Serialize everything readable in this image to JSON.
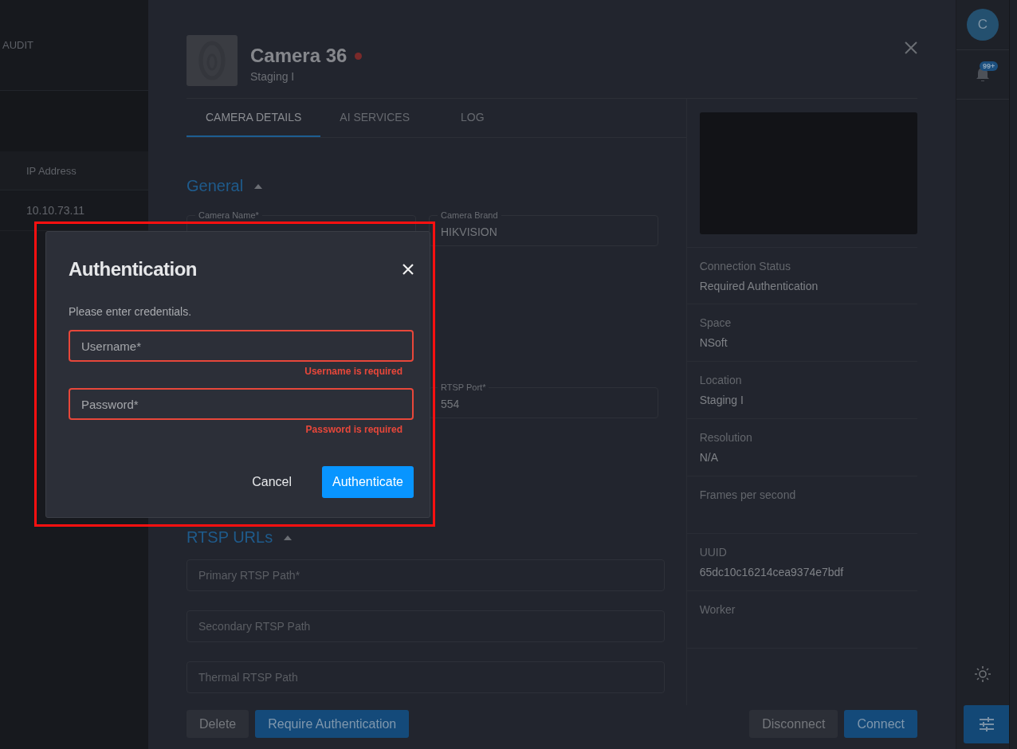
{
  "background_list": {
    "tab": "AUDIT",
    "column": "IP Address",
    "rows": [
      "10.10.73.11"
    ]
  },
  "camera": {
    "name": "Camera 36",
    "online": false,
    "subtitle": "Staging I"
  },
  "tabs": [
    {
      "label": "CAMERA DETAILS",
      "selected": true
    },
    {
      "label": "AI SERVICES",
      "selected": false
    },
    {
      "label": "LOG",
      "selected": false
    }
  ],
  "general": {
    "title": "General",
    "expanded": true,
    "fields": [
      {
        "label": "Camera Name*"
      },
      {
        "label": "Camera Brand",
        "value": "HIKVISION"
      },
      {
        "label": "RTSP Port*",
        "value": "554"
      }
    ]
  },
  "rtsp_urls": {
    "title": "RTSP URLs",
    "expanded": true,
    "fields": [
      {
        "placeholder": "Primary RTSP Path*"
      },
      {
        "placeholder": "Secondary RTSP Path"
      },
      {
        "placeholder": "Thermal RTSP Path"
      }
    ]
  },
  "info": [
    {
      "label": "Connection Status",
      "value": "Required Authentication"
    },
    {
      "label": "Space",
      "value": "NSoft"
    },
    {
      "label": "Location",
      "value": "Staging I"
    },
    {
      "label": "Resolution",
      "value": "N/A"
    },
    {
      "label": "Frames per second"
    },
    {
      "label": "UUID",
      "value": "65dc10c16214cea9374e7bdf"
    },
    {
      "label": "Worker"
    }
  ],
  "footer": {
    "left": [
      {
        "label": "Delete",
        "kind": "secondary"
      },
      {
        "label": "Require Authentication",
        "kind": "primary"
      }
    ],
    "right": [
      {
        "label": "Disconnect",
        "kind": "secondary"
      },
      {
        "label": "Connect",
        "kind": "primary"
      }
    ]
  },
  "rail": {
    "avatar": "C",
    "badge": "99+"
  },
  "dialog": {
    "title": "Authentication",
    "message": "Please enter credentials.",
    "fields": [
      {
        "placeholder": "Username*",
        "error": "Username is required"
      },
      {
        "placeholder": "Password*",
        "error": "Password is required"
      }
    ],
    "buttons": [
      {
        "label": "Cancel",
        "kind": "text"
      },
      {
        "label": "Authenticate",
        "kind": "primary"
      }
    ]
  }
}
